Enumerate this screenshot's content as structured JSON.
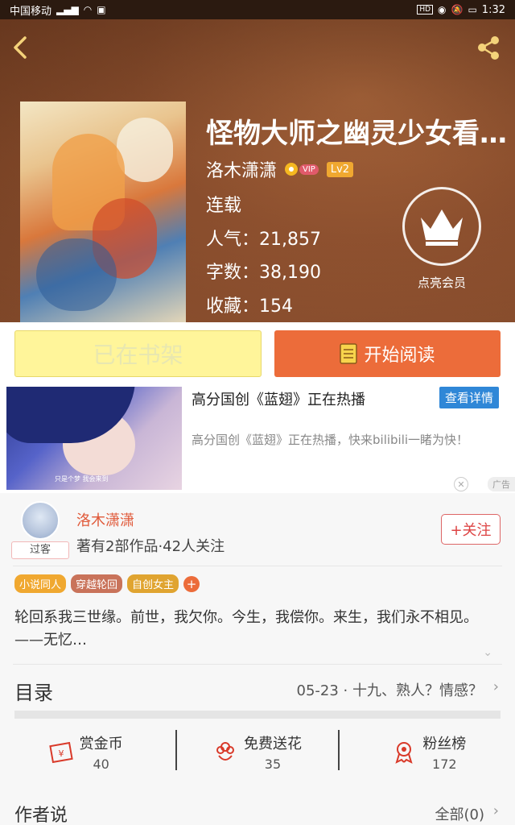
{
  "statusbar": {
    "carrier": "中国移动",
    "network": "⁴⁶",
    "time": "1:32",
    "hd_badge": "HD"
  },
  "book": {
    "title": "怪物大师之幽灵少女看…",
    "author": "洛木潇潇",
    "vip_label": "VIP",
    "level": "Lv2",
    "status": "连载",
    "popularity": "人气：21,857",
    "word_count": "字数：38,190",
    "favorites": "收藏：154"
  },
  "vip_member": {
    "label": "点亮会员"
  },
  "buttons": {
    "on_shelf": "已在书架",
    "start_reading": "开始阅读"
  },
  "ad": {
    "title": "高分国创《蓝翅》正在热播",
    "detail_button": "查看详情",
    "description": "高分国创《蓝翅》正在热播，快来bilibili一睹为快！",
    "tag": "广告",
    "image_caption": "只是个梦 我会来到"
  },
  "author_card": {
    "name": "洛木潇潇",
    "stats": "著有2部作品·42人关注",
    "avatar_tag": "过客",
    "follow_button": "+关注"
  },
  "tags": [
    {
      "label": "小说同人",
      "color": "#f0a830"
    },
    {
      "label": "穿越轮回",
      "color": "#c9735a"
    },
    {
      "label": "自创女主",
      "color": "#e0a430"
    }
  ],
  "tag_add": "+",
  "intro": "轮回系我三世缘。前世，我欠你。今生，我偿你。来生，我们永不相见。——无忆…",
  "toc": {
    "label": "目录",
    "latest": "05-23 · 十九、熟人？情感？"
  },
  "actions": [
    {
      "label": "赏金币",
      "count": "40",
      "icon": "coin-envelope-icon"
    },
    {
      "label": "免费送花",
      "count": "35",
      "icon": "flower-icon"
    },
    {
      "label": "粉丝榜",
      "count": "172",
      "icon": "medal-icon"
    }
  ],
  "author_says": {
    "label": "作者说",
    "all": "全部(0)"
  },
  "colors": {
    "accent": "#ec6c3a",
    "shelf_button": "#fff59a",
    "ad_button": "#2f87d7"
  }
}
